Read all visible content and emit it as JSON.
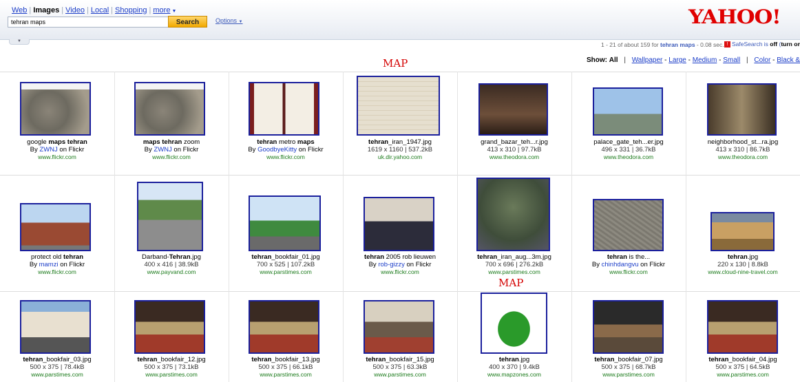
{
  "header": {
    "tabs": [
      {
        "label": "Web",
        "active": false
      },
      {
        "label": "Images",
        "active": true
      },
      {
        "label": "Video",
        "active": false
      },
      {
        "label": "Local",
        "active": false
      },
      {
        "label": "Shopping",
        "active": false
      },
      {
        "label": "more",
        "active": false
      }
    ],
    "search_value": "tehran maps",
    "search_button": "Search",
    "options_label": "Options",
    "logo_text": "YAHOO!"
  },
  "results_info": {
    "prefix": "1 - 21 of about 159 for ",
    "query": "tehran maps",
    "suffix": " - 0.08 sec."
  },
  "safesearch": {
    "label": "SafeSearch is ",
    "state": "off",
    "link": "turn on"
  },
  "show_bar": {
    "show_label": "Show:",
    "all": "All",
    "size_links": [
      "Wallpaper",
      "Large",
      "Medium",
      "Small"
    ],
    "color_links": [
      "Color",
      "Black & White"
    ]
  },
  "annotations": [
    "MAP",
    "MAP"
  ],
  "colors": {
    "accent": "#1a3cc8",
    "brand": "#e00000",
    "url": "#1a7a1a",
    "thumb_border": "#1a1f9c",
    "annotation": "#d40000"
  },
  "results": [
    {
      "t1": "google ",
      "t1b": "maps tehran",
      "t2": "",
      "line2_type": "flickr",
      "author": "ZWNJ",
      "url": "www.flickr.com",
      "img": "aerial"
    },
    {
      "t1": "",
      "t1b": "maps tehran",
      "t2": " zoom",
      "line2_type": "flickr",
      "author": "ZWNJ",
      "url": "www.flickr.com",
      "img": "aerial"
    },
    {
      "t1": "",
      "t1b": "tehran",
      "t2": " metro ",
      "t3b": "maps",
      "line2_type": "flickr",
      "author": "GoodbyeKitty",
      "url": "www.flickr.com",
      "img": "metro"
    },
    {
      "t1": "",
      "t1b": "tehran",
      "t2": "_iran_1947.jpg",
      "line2_type": "meta",
      "meta": "1619 x 1160 | 537.2kB",
      "url": "uk.dir.yahoo.com",
      "img": "oldmap"
    },
    {
      "t1": "grand_bazar_teh...r.jpg",
      "t1b": "",
      "t2": "",
      "line2_type": "meta",
      "meta": "413 x 310 | 97.7kB",
      "url": "www.theodora.com",
      "img": "bazaar"
    },
    {
      "t1": "palace_gate_teh...er.jpg",
      "t1b": "",
      "t2": "",
      "line2_type": "meta",
      "meta": "496 x 331 | 36.7kB",
      "url": "www.theodora.com",
      "img": "gate"
    },
    {
      "t1": "neighborhood_st...ra.jpg",
      "t1b": "",
      "t2": "",
      "line2_type": "meta",
      "meta": "413 x 310 | 86.7kB",
      "url": "www.theodora.com",
      "img": "street"
    },
    {
      "t1": "protect old ",
      "t1b": "tehran",
      "t2": "",
      "line2_type": "flickr",
      "author": "mamzi",
      "url": "www.flickr.com",
      "img": "gate2"
    },
    {
      "t1": "Darband-",
      "t1b": "Tehran",
      "t2": ".jpg",
      "line2_type": "meta",
      "meta": "400 x 416 | 38.9kB",
      "url": "www.payvand.com",
      "img": "mountain"
    },
    {
      "t1": "",
      "t1b": "tehran",
      "t2": "_bookfair_01.jpg",
      "line2_type": "meta",
      "meta": "700 x 525 | 107.2kB",
      "url": "www.parstimes.com",
      "img": "fair_out"
    },
    {
      "t1": "",
      "t1b": "tehran",
      "t2": " 2005 rob lieuwen",
      "line2_type": "flickr",
      "author": "rob-gizzy",
      "url": "www.flickr.com",
      "img": "group"
    },
    {
      "t1": "",
      "t1b": "tehran",
      "t2": "_iran_aug...3m.jpg",
      "line2_type": "meta",
      "meta": "700 x 696 | 276.2kB",
      "url": "www.parstimes.com",
      "img": "sat"
    },
    {
      "t1": "",
      "t1b": "tehran",
      "t2": " is the...",
      "line2_type": "flickr",
      "author": "chinhdangvu",
      "url": "www.flickr.com",
      "img": "aerial2"
    },
    {
      "t1": "",
      "t1b": "tehran",
      "t2": ".jpg",
      "line2_type": "meta",
      "meta": "220 x 130 | 8.8kB",
      "url": "www.cloud-nine-travel.com",
      "img": "ruins"
    },
    {
      "t1": "",
      "t1b": "tehran",
      "t2": "_bookfair_03.jpg",
      "line2_type": "meta",
      "meta": "500 x 375 | 78.4kB",
      "url": "www.parstimes.com",
      "img": "billboard"
    },
    {
      "t1": "",
      "t1b": "tehran",
      "t2": "_bookfair_12.jpg",
      "line2_type": "meta",
      "meta": "500 x 375 | 73.1kB",
      "url": "www.parstimes.com",
      "img": "fair_in"
    },
    {
      "t1": "",
      "t1b": "tehran",
      "t2": "_bookfair_13.jpg",
      "line2_type": "meta",
      "meta": "500 x 375 | 66.1kB",
      "url": "www.parstimes.com",
      "img": "fair_in"
    },
    {
      "t1": "",
      "t1b": "tehran",
      "t2": "_bookfair_15.jpg",
      "line2_type": "meta",
      "meta": "500 x 375 | 63.3kB",
      "url": "www.parstimes.com",
      "img": "fair_people"
    },
    {
      "t1": "",
      "t1b": "tehran",
      "t2": ".jpg",
      "line2_type": "meta",
      "meta": "400 x 370 | 9.4kB",
      "url": "www.mapzones.com",
      "img": "greenmap"
    },
    {
      "t1": "",
      "t1b": "tehran",
      "t2": "_bookfair_07.jpg",
      "line2_type": "meta",
      "meta": "500 x 375 | 68.7kB",
      "url": "www.parstimes.com",
      "img": "fair_in2"
    },
    {
      "t1": "",
      "t1b": "tehran",
      "t2": "_bookfair_04.jpg",
      "line2_type": "meta",
      "meta": "500 x 375 | 64.5kB",
      "url": "www.parstimes.com",
      "img": "fair_in"
    }
  ]
}
